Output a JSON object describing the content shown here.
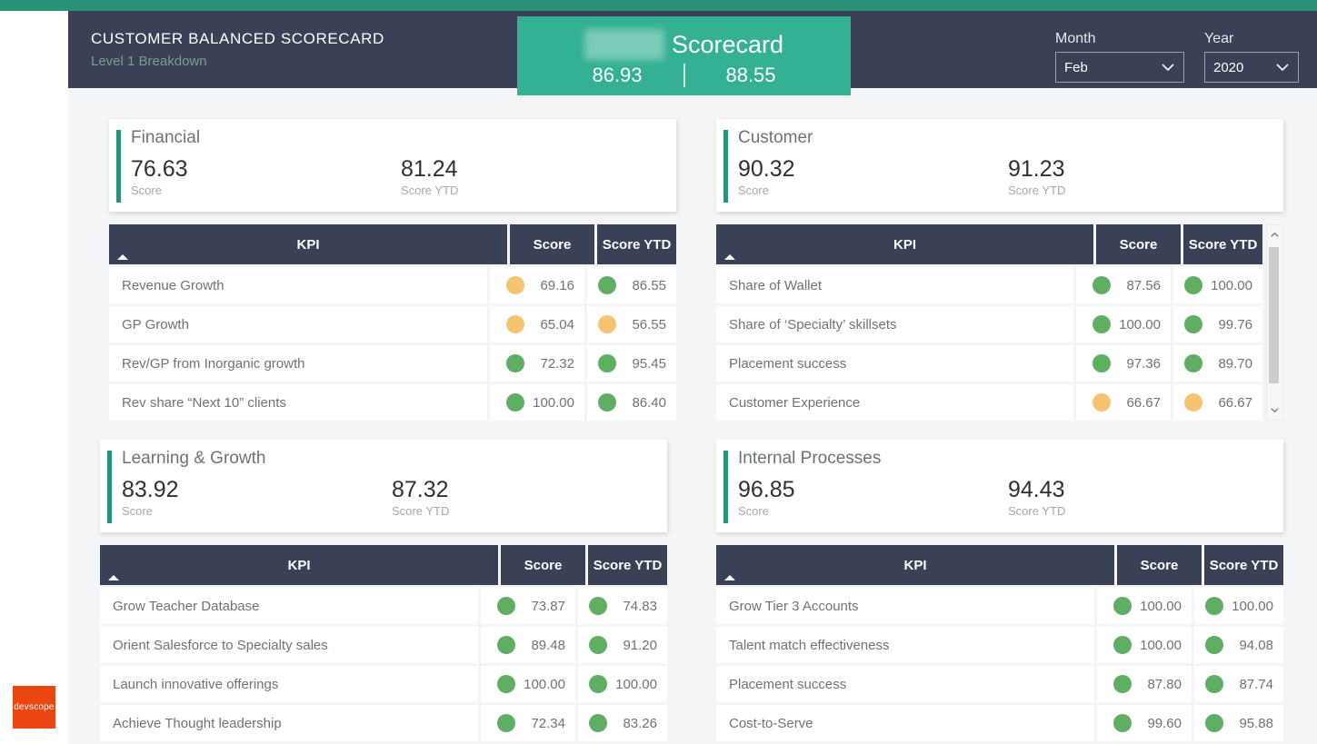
{
  "header": {
    "title": "CUSTOMER BALANCED SCORECARD",
    "subtitle": "Level 1 Breakdown",
    "logo_icon": "gauge-bars-icon"
  },
  "banner": {
    "redacted_prefix": "Kelly BU",
    "title": "Scorecard",
    "score": "86.93",
    "score_ytd": "88.55"
  },
  "filters": {
    "month": {
      "label": "Month",
      "value": "Feb"
    },
    "year": {
      "label": "Year",
      "value": "2020"
    },
    "chevron_icon": "chevron-down-icon"
  },
  "brand": {
    "logo_text": "devscope",
    "logo_color": "#eb4511"
  },
  "colors": {
    "teal": "#2a9377",
    "banner_teal": "#34b092",
    "navy": "#3a4055",
    "green_dot": "#5fae63",
    "amber_dot": "#f5c470",
    "page_bg": "#f4f5f6"
  },
  "table_headers": {
    "kpi": "KPI",
    "score": "Score",
    "score_ytd": "Score YTD"
  },
  "labels": {
    "score": "Score",
    "score_ytd": "Score YTD"
  },
  "quadrants": [
    {
      "name": "Financial",
      "score": "76.63",
      "score_ytd": "81.24",
      "has_scrollbar": false,
      "rows": [
        {
          "kpi": "Revenue Growth",
          "score": "69.16",
          "score_status": "amber",
          "ytd": "86.55",
          "ytd_status": "green"
        },
        {
          "kpi": "GP Growth",
          "score": "65.04",
          "score_status": "amber",
          "ytd": "56.55",
          "ytd_status": "amber"
        },
        {
          "kpi": "Rev/GP from Inorganic growth",
          "score": "72.32",
          "score_status": "green",
          "ytd": "95.45",
          "ytd_status": "green"
        },
        {
          "kpi": "Rev share “Next 10” clients",
          "score": "100.00",
          "score_status": "green",
          "ytd": "86.40",
          "ytd_status": "green"
        }
      ]
    },
    {
      "name": "Customer",
      "score": "90.32",
      "score_ytd": "91.23",
      "has_scrollbar": true,
      "rows": [
        {
          "kpi": "Share of Wallet",
          "score": "87.56",
          "score_status": "green",
          "ytd": "100.00",
          "ytd_status": "green"
        },
        {
          "kpi": "Share of ‘Specialty’ skillsets",
          "score": "100.00",
          "score_status": "green",
          "ytd": "99.76",
          "ytd_status": "green"
        },
        {
          "kpi": "Placement success",
          "score": "97.36",
          "score_status": "green",
          "ytd": "89.70",
          "ytd_status": "green"
        },
        {
          "kpi": "Customer Experience",
          "score": "66.67",
          "score_status": "amber",
          "ytd": "66.67",
          "ytd_status": "amber"
        }
      ]
    },
    {
      "name": "Learning & Growth",
      "score": "83.92",
      "score_ytd": "87.32",
      "has_scrollbar": false,
      "rows": [
        {
          "kpi": "Grow Teacher Database",
          "score": "73.87",
          "score_status": "green",
          "ytd": "74.83",
          "ytd_status": "green"
        },
        {
          "kpi": "Orient Salesforce to Specialty sales",
          "score": "89.48",
          "score_status": "green",
          "ytd": "91.20",
          "ytd_status": "green"
        },
        {
          "kpi": "Launch innovative offerings",
          "score": "100.00",
          "score_status": "green",
          "ytd": "100.00",
          "ytd_status": "green"
        },
        {
          "kpi": "Achieve Thought leadership",
          "score": "72.34",
          "score_status": "green",
          "ytd": "83.26",
          "ytd_status": "green"
        }
      ]
    },
    {
      "name": "Internal Processes",
      "score": "96.85",
      "score_ytd": "94.43",
      "has_scrollbar": false,
      "rows": [
        {
          "kpi": "Grow Tier 3 Accounts",
          "score": "100.00",
          "score_status": "green",
          "ytd": "100.00",
          "ytd_status": "green"
        },
        {
          "kpi": "Talent match effectiveness",
          "score": "100.00",
          "score_status": "green",
          "ytd": "94.08",
          "ytd_status": "green"
        },
        {
          "kpi": "Placement success",
          "score": "87.80",
          "score_status": "green",
          "ytd": "87.74",
          "ytd_status": "green"
        },
        {
          "kpi": "Cost-to-Serve",
          "score": "99.60",
          "score_status": "green",
          "ytd": "95.88",
          "ytd_status": "green"
        }
      ]
    }
  ]
}
